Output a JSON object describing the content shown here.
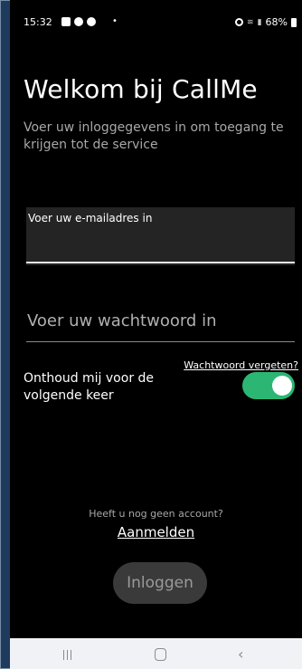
{
  "status_bar": {
    "time": "15:32",
    "notification_icons": [
      "gallery-icon",
      "messenger-icon",
      "chat-icon"
    ],
    "dot": "•",
    "right_icons": [
      "alarm-icon",
      "wifi-icon",
      "signal-icon"
    ],
    "battery": "68%"
  },
  "login": {
    "title": "Welkom bij CallMe",
    "subtitle": "Voer uw inloggegevens in om toegang te krijgen tot de service",
    "email_label": "Voer uw e-mailadres in",
    "password_placeholder": "Voer uw wachtwoord in",
    "forgot_password": "Wachtwoord vergeten?",
    "remember_me": "Onthoud mij voor de volgende keer",
    "remember_me_enabled": true,
    "toggle_color": "#2bb673",
    "no_account": "Heeft u nog geen account?",
    "signup": "Aanmelden",
    "login_button": "Inloggen"
  },
  "nav_bar": {
    "buttons": [
      "recent-apps-icon",
      "home-icon",
      "back-icon"
    ]
  }
}
